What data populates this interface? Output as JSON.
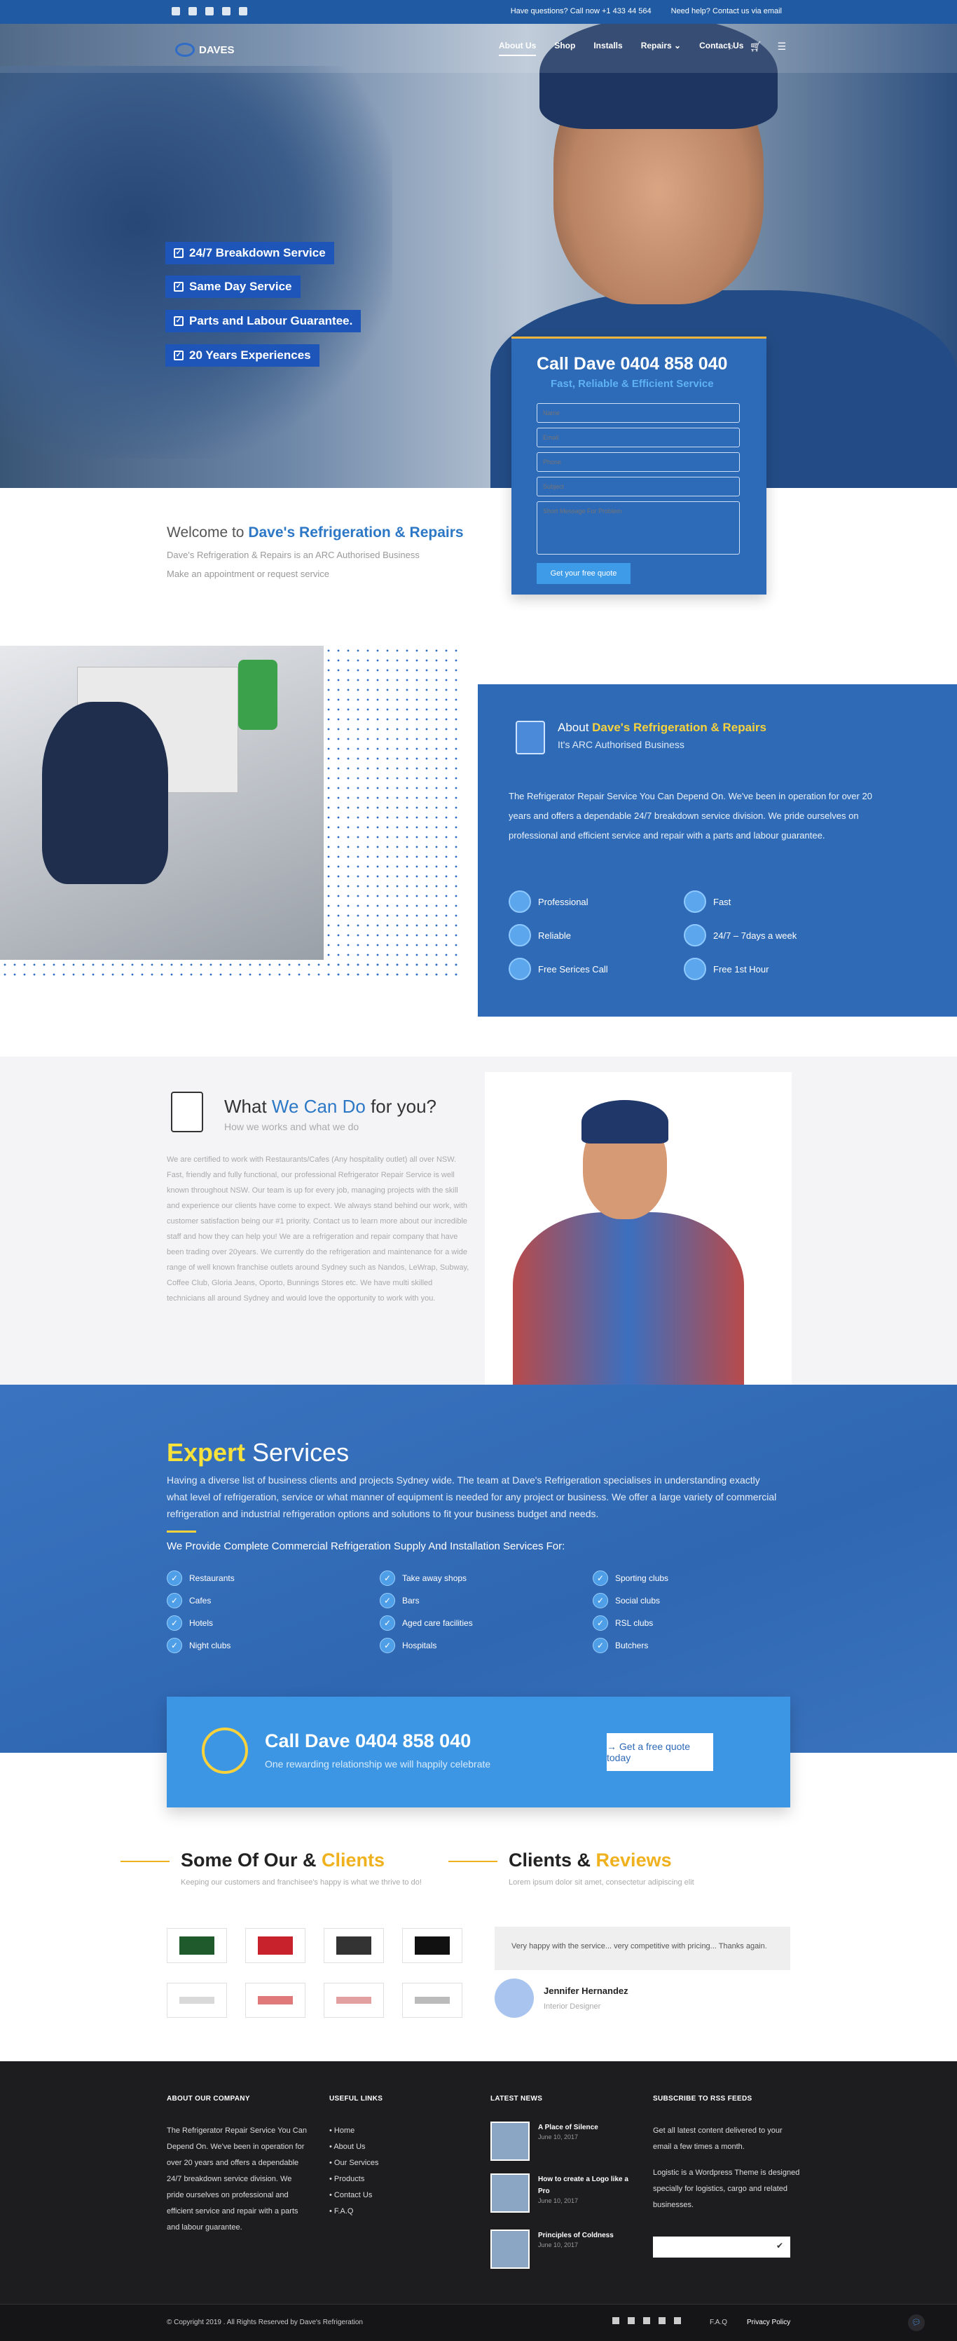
{
  "topbar": {
    "phone_text": "Have questions? Call now +1 433 44 564",
    "help_text": "Need help? Contact us via email"
  },
  "nav": {
    "logo": "DAVES",
    "items": [
      "About Us",
      "Shop",
      "Installs",
      "Repairs ⌄",
      "Contact Us"
    ]
  },
  "hero": {
    "badges": [
      "24/7 Breakdown Service",
      "Same Day Service",
      "Parts and Labour Guarantee.",
      "20 Years Experiences"
    ]
  },
  "quote_form": {
    "title": "Call Dave 0404 858 040",
    "subtitle": "Fast, Reliable & Efficient Service",
    "placeholders": {
      "name": "Name",
      "email": "Email",
      "phone": "Phone",
      "subject": "Subject",
      "message": "Short Message For Problem"
    },
    "button": "Get your free quote"
  },
  "welcome": {
    "prefix": "Welcome to ",
    "brand": "Dave's Refrigeration & Repairs",
    "line1": "Dave's Refrigeration & Repairs is an ARC Authorised Business",
    "line2": "Make an appointment or request service"
  },
  "about": {
    "prefix": "About ",
    "brand": "Dave's Refrigeration & Repairs",
    "sub": "It's ARC Authorised Business",
    "desc": "The Refrigerator Repair Service You Can Depend On. We've been in operation for over 20 years and offers a dependable 24/7 breakdown service division. We pride ourselves on professional and efficient service and repair with a parts and labour guarantee.",
    "features": [
      "Professional",
      "Fast",
      "Reliable",
      "24/7 – 7days a week",
      "Free Serices Call",
      "Free 1st Hour"
    ]
  },
  "what": {
    "prefix": "What ",
    "accent": "We Can Do",
    "suffix": " for you?",
    "sub": "How we works and what we do",
    "text": "We are certified to work with Restaurants/Cafes (Any hospitality outlet) all over NSW. Fast, friendly and fully functional, our professional Refrigerator Repair Service is well known throughout NSW. Our team is up for every job, managing projects with the skill and experience our clients have come to expect. We always stand behind our work, with customer satisfaction being our #1 priority. Contact us to learn more about our incredible staff and how they can help you! We are a refrigeration and repair company that have been trading over 20years. We currently do the refrigeration and maintenance for a wide range of well known franchise outlets around Sydney such as Nandos, LeWrap, Subway, Coffee Club, Gloria Jeans, Oporto, Bunnings Stores etc. We have multi skilled technicians all around Sydney and would love the opportunity to work with you."
  },
  "expert": {
    "accent": "Expert",
    "title": " Services",
    "desc": "Having a diverse list of business clients and projects Sydney wide. The team at Dave's Refrigeration specialises in understanding exactly what level of refrigeration, service or what manner of equipment is needed for any project or business. We offer a large variety of commercial refrigeration and industrial refrigeration options and solutions to fit your business budget and needs.",
    "provide": "We Provide Complete Commercial Refrigeration Supply And Installation Services For:",
    "col1": [
      "Restaurants",
      "Cafes",
      "Hotels",
      "Night clubs"
    ],
    "col2": [
      "Take away shops",
      "Bars",
      "Aged care facilities",
      "Hospitals"
    ],
    "col3": [
      "Sporting clubs",
      "Social clubs",
      "RSL clubs",
      "Butchers"
    ]
  },
  "cta": {
    "title": "Call Dave 0404 858 040",
    "sub": "One rewarding relationship we will happily celebrate",
    "button": "→  Get a free quote today"
  },
  "clients": {
    "prefix": "Some Of Our & ",
    "accent": "Clients",
    "sub": "Keeping our customers and franchisee's happy is what we thrive to do!"
  },
  "reviews": {
    "prefix": "Clients & ",
    "accent": "Reviews",
    "sub": "Lorem ipsum dolor sit amet, consectetur adipiscing elit",
    "quote": "Very happy with the service... very competitive with pricing... Thanks again.",
    "name": "Jennifer Hernandez",
    "role": "Interior Designer"
  },
  "footer": {
    "about_title": "ABOUT OUR COMPANY",
    "about_text": "The Refrigerator Repair Service You Can Depend On. We've been in operation for over 20 years and offers a dependable 24/7 breakdown service division. We pride ourselves on professional and efficient service and repair with a parts and labour guarantee.",
    "links_title": "USEFUL LINKS",
    "links": [
      "Home",
      "About Us",
      "Our Services",
      "Products",
      "Contact Us",
      "F.A.Q"
    ],
    "news_title": "LATEST NEWS",
    "news": [
      {
        "title": "A Place of Silence",
        "date": "June 10, 2017"
      },
      {
        "title": "How to create a Logo like a Pro",
        "date": "June 10, 2017"
      },
      {
        "title": "Principles of Coldness",
        "date": "June 10, 2017"
      }
    ],
    "rss_title": "SUBSCRIBE TO RSS FEEDS",
    "rss_text1": "Get all latest content delivered to your email a few times a month.",
    "rss_text2": "Logistic is a Wordpress Theme is designed specially for logistics, cargo and related businesses.",
    "copyright": "© Copyright 2019 . All Rights Reserved by Dave's Refrigeration",
    "faq": "F.A.Q",
    "privacy": "Privacy Policy"
  },
  "colors": {
    "primary": "#2e6ab6",
    "accent": "#f0b11e",
    "footer": "#1d1d1f"
  }
}
